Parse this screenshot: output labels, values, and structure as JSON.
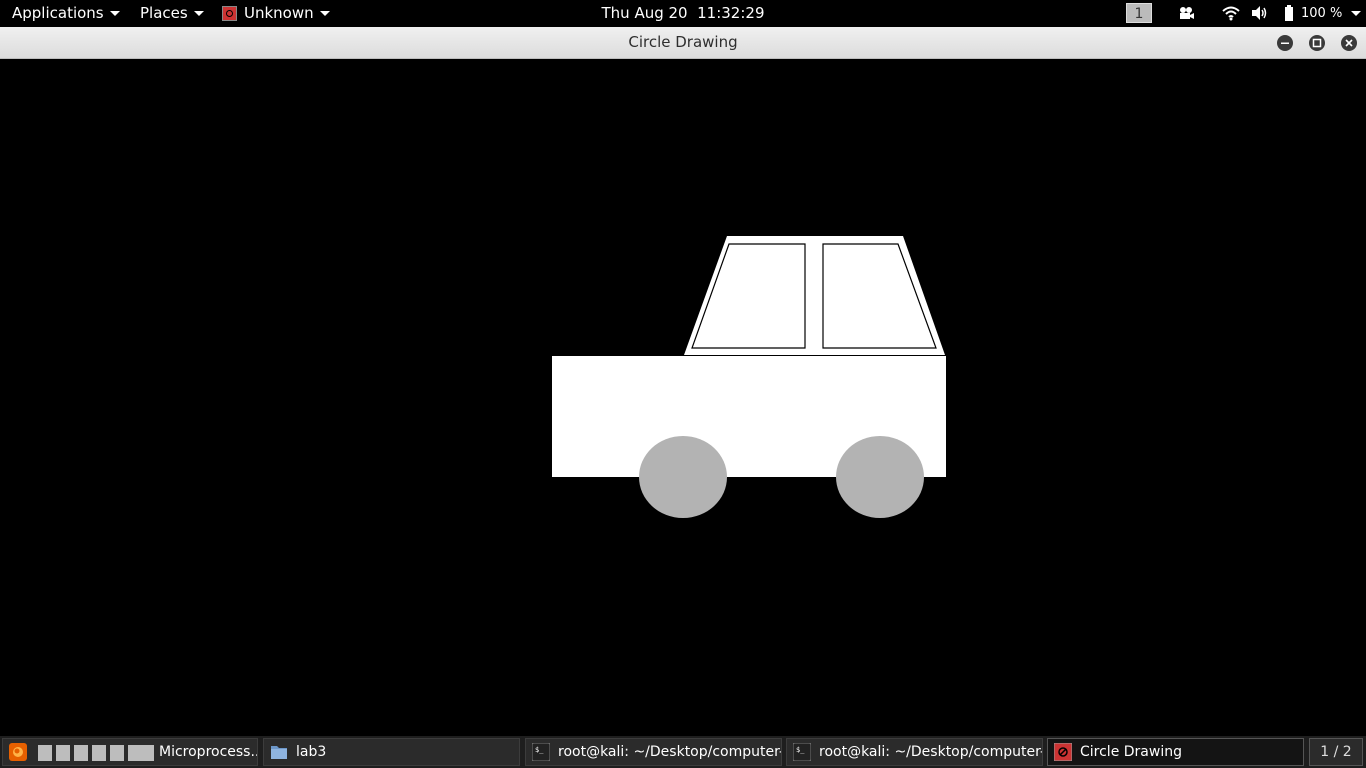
{
  "top_panel": {
    "applications_label": "Applications",
    "places_label": "Places",
    "focused_app_label": "Unknown",
    "clock": "Thu Aug 20  11:32:29",
    "workspace_number": "1",
    "battery_percent": "100 %"
  },
  "window": {
    "title": "Circle Drawing",
    "controls": [
      "minimize-icon",
      "maximize-icon",
      "close-icon"
    ]
  },
  "drawing": {
    "background_color": "#000000",
    "body_color": "#ffffff",
    "wheel_color": "#b3b3b3",
    "outline_color": "#000000"
  },
  "taskbar": {
    "tasks": [
      {
        "label": "Microprocess...",
        "icon": "firefox-icon"
      },
      {
        "label": "lab3",
        "icon": "folder-icon"
      },
      {
        "label": "root@kali: ~/Desktop/computer-...",
        "icon": "terminal-icon"
      },
      {
        "label": "root@kali: ~/Desktop/computer-...",
        "icon": "terminal-icon"
      },
      {
        "label": "Circle Drawing",
        "icon": "circle-drawing-app-icon"
      }
    ],
    "pager": "1 / 2"
  }
}
